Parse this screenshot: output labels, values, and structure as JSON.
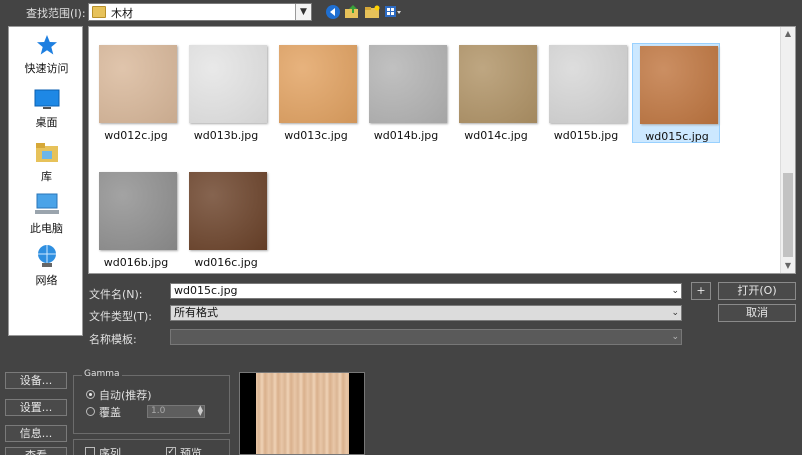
{
  "toolbar": {
    "lookin_label": "查找范围(I):",
    "lookin_value": "木材",
    "nav_icons": [
      "back-icon",
      "up-folder-icon",
      "new-folder-icon",
      "view-menu-icon"
    ]
  },
  "places": [
    {
      "label": "快速访问",
      "icon": "star-icon"
    },
    {
      "label": "桌面",
      "icon": "desktop-icon"
    },
    {
      "label": "库",
      "icon": "library-icon"
    },
    {
      "label": "此电脑",
      "icon": "computer-icon"
    },
    {
      "label": "网络",
      "icon": "network-icon"
    }
  ],
  "files": [
    {
      "name": "wd012c.jpg",
      "color": "#d9b89a",
      "selected": false
    },
    {
      "name": "wd013b.jpg",
      "color": "#e4e4e4",
      "selected": false
    },
    {
      "name": "wd013c.jpg",
      "color": "#e2a261",
      "selected": false
    },
    {
      "name": "wd014b.jpg",
      "color": "#b3b3b3",
      "selected": false
    },
    {
      "name": "wd014c.jpg",
      "color": "#b09366",
      "selected": false
    },
    {
      "name": "wd015b.jpg",
      "color": "#d6d6d6",
      "selected": false
    },
    {
      "name": "wd015c.jpg",
      "color": "#c07640",
      "selected": true
    },
    {
      "name": "wd016b.jpg",
      "color": "#8f8f8f",
      "selected": false
    },
    {
      "name": "wd016c.jpg",
      "color": "#6b4229",
      "selected": false
    }
  ],
  "form": {
    "filename_label": "文件名(N):",
    "filename_value": "wd015c.jpg",
    "plus_label": "+",
    "open_label": "打开(O)",
    "filetype_label": "文件类型(T):",
    "filetype_value": "所有格式",
    "cancel_label": "取消",
    "template_label": "名称模板:"
  },
  "side_buttons": [
    "设备...",
    "设置...",
    "信息...",
    "查看"
  ],
  "gamma": {
    "title": "Gamma",
    "auto_label": "自动(推荐)",
    "override_label": "覆盖",
    "override_value": "1.0",
    "sequence_label": "序列",
    "preview_label": "预览",
    "sequence_checked": false,
    "preview_checked": true
  }
}
